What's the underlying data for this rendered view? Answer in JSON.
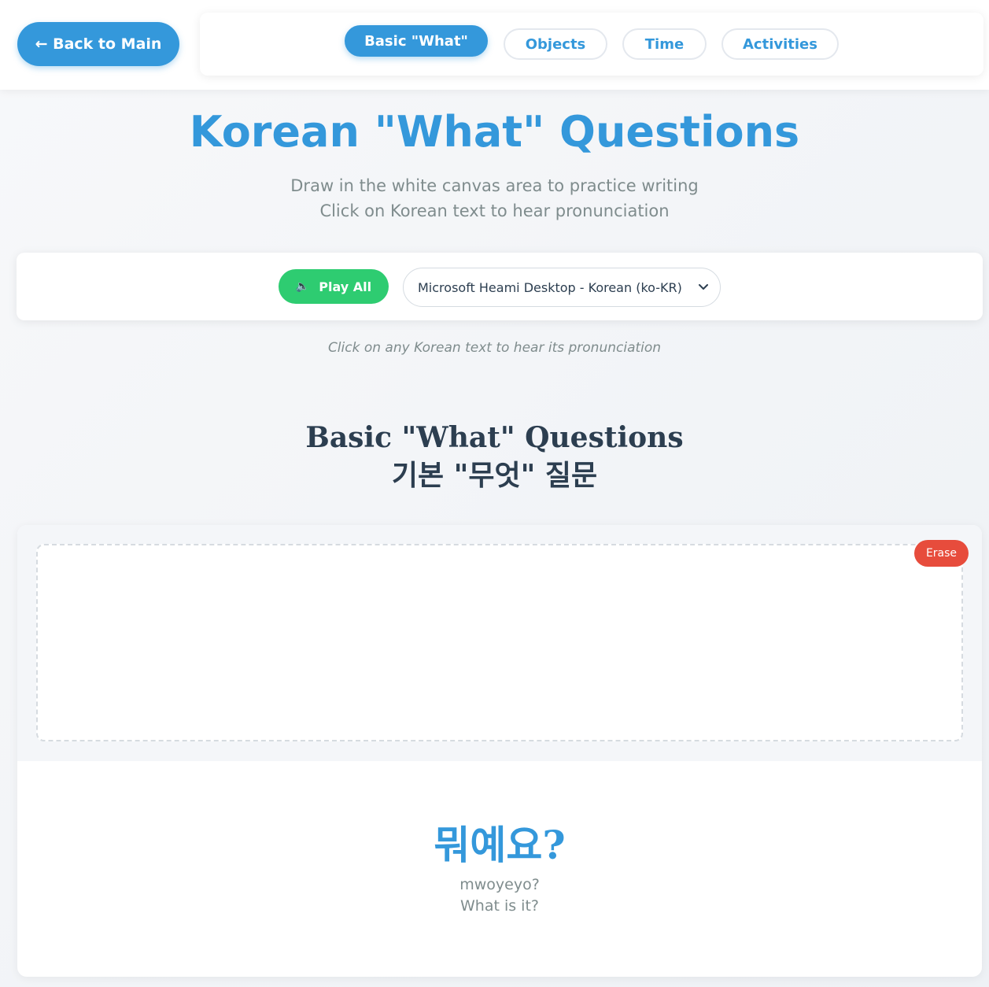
{
  "nav": {
    "back_label": "← Back to Main",
    "tabs": [
      {
        "label": "Basic \"What\"",
        "active": true
      },
      {
        "label": "Objects",
        "active": false
      },
      {
        "label": "Time",
        "active": false
      },
      {
        "label": "Activities",
        "active": false
      }
    ]
  },
  "header": {
    "title": "Korean \"What\" Questions",
    "subtitle_line1": "Draw in the white canvas area to practice writing",
    "subtitle_line2": "Click on Korean text to hear pronunciation"
  },
  "controls": {
    "play_all_label": "Play All",
    "speaker_icon": "speaker-icon",
    "voice_selected": "Microsoft Heami Desktop - Korean (ko-KR)",
    "hint": "Click on any Korean text to hear its pronunciation"
  },
  "section": {
    "title_en": "Basic \"What\" Questions",
    "title_ko": "기본 \"무엇\" 질문"
  },
  "card": {
    "erase_label": "Erase",
    "korean": "뭐예요?",
    "romanization": "mwoyeyo?",
    "english": "What is it?"
  },
  "colors": {
    "accent": "#3498db",
    "play": "#2ecc71",
    "erase": "#e74c3c",
    "muted_text": "#7f8c8d",
    "heading_text": "#2c3e50"
  }
}
